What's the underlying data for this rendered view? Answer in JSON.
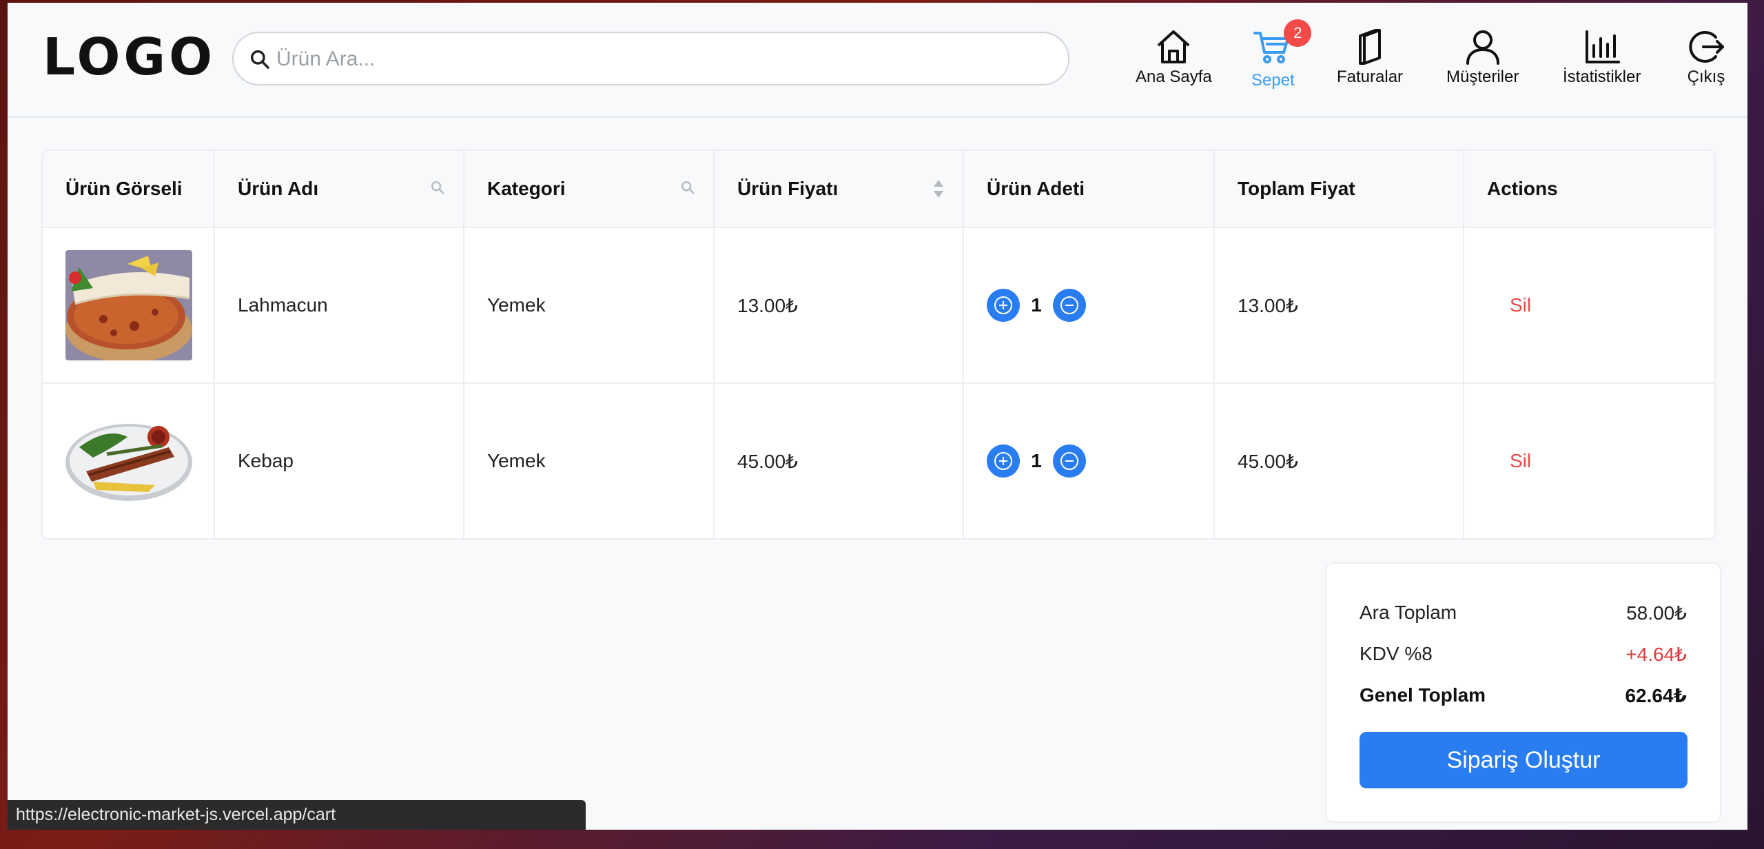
{
  "header": {
    "logo": "LOGO",
    "search_placeholder": "Ürün Ara...",
    "nav": [
      {
        "label": "Ana Sayfa",
        "icon": "home-icon"
      },
      {
        "label": "Sepet",
        "icon": "cart-icon",
        "badge": "2",
        "active": true
      },
      {
        "label": "Faturalar",
        "icon": "invoices-icon"
      },
      {
        "label": "Müşteriler",
        "icon": "user-icon"
      },
      {
        "label": "İstatistikler",
        "icon": "stats-icon"
      },
      {
        "label": "Çıkış",
        "icon": "logout-icon"
      }
    ]
  },
  "table": {
    "columns": [
      "Ürün Görseli",
      "Ürün Adı",
      "Kategori",
      "Ürün Fiyatı",
      "Ürün Adeti",
      "Toplam Fiyat",
      "Actions"
    ],
    "rows": [
      {
        "image": "lahmacun-image",
        "name": "Lahmacun",
        "category": "Yemek",
        "price": "13.00₺",
        "qty": "1",
        "total": "13.00₺",
        "action": "Sil"
      },
      {
        "image": "kebap-image",
        "name": "Kebap",
        "category": "Yemek",
        "price": "45.00₺",
        "qty": "1",
        "total": "45.00₺",
        "action": "Sil"
      }
    ]
  },
  "summary": {
    "subtotal_label": "Ara Toplam",
    "subtotal_value": "58.00₺",
    "tax_label": "KDV %8",
    "tax_value": "+4.64₺",
    "total_label": "Genel Toplam",
    "total_value": "62.64₺",
    "order_button": "Sipariş Oluştur"
  },
  "status_url": "https://electronic-market-js.vercel.app/cart",
  "colors": {
    "accent": "#2a7df0",
    "active_nav": "#3a9bf0",
    "danger": "#e84b4b",
    "badge": "#f24949"
  }
}
